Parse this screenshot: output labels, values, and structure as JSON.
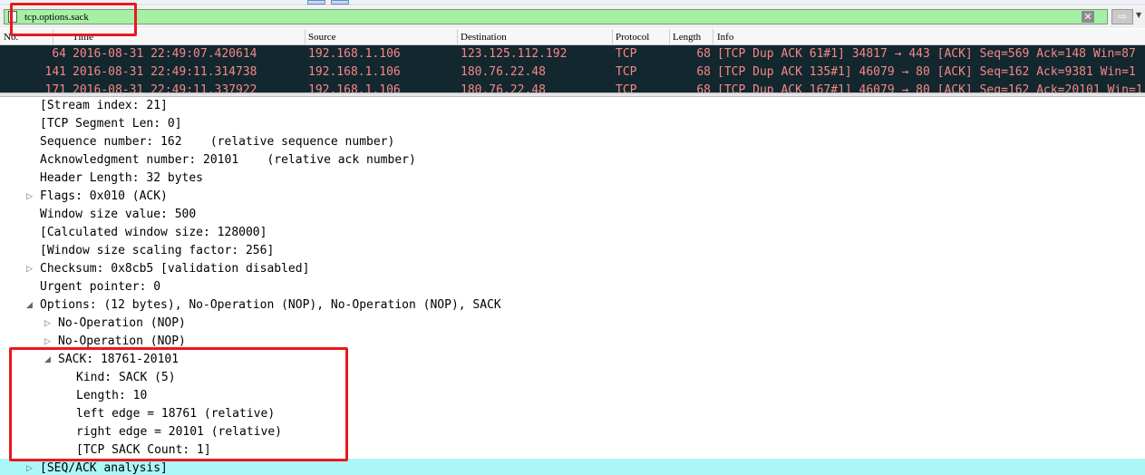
{
  "filter": {
    "value": "tcp.options.sack",
    "clear_glyph": "✕",
    "apply_glyph": "⇨",
    "dropdown_glyph": "▼"
  },
  "columns": [
    "No.",
    "Time",
    "Source",
    "Destination",
    "Protocol",
    "Length",
    "Info"
  ],
  "packets": [
    {
      "no": "64",
      "time": "2016-08-31 22:49:07.420614",
      "source": "192.168.1.106",
      "destination": "123.125.112.192",
      "protocol": "TCP",
      "length": "68",
      "info": "[TCP Dup ACK 61#1] 34817 → 443 [ACK] Seq=569 Ack=148 Win=87"
    },
    {
      "no": "141",
      "time": "2016-08-31 22:49:11.314738",
      "source": "192.168.1.106",
      "destination": "180.76.22.48",
      "protocol": "TCP",
      "length": "68",
      "info": "[TCP Dup ACK 135#1] 46079 → 80 [ACK] Seq=162 Ack=9381 Win=1"
    },
    {
      "no": "171",
      "time": "2016-08-31 22:49:11.337922",
      "source": "192.168.1.106",
      "destination": "180.76.22.48",
      "protocol": "TCP",
      "length": "68",
      "info": "[TCP Dup ACK 167#1] 46079 → 80 [ACK] Seq=162 Ack=20101 Win=1"
    }
  ],
  "tree": [
    {
      "text": "[Stream index: 21]",
      "level": 0
    },
    {
      "text": "[TCP Segment Len: 0]",
      "level": 0
    },
    {
      "text": "Sequence number: 162    (relative sequence number)",
      "level": 0
    },
    {
      "text": "Acknowledgment number: 20101    (relative ack number)",
      "level": 0
    },
    {
      "text": "Header Length: 32 bytes",
      "level": 0
    },
    {
      "text": "Flags: 0x010 (ACK)",
      "level": 0,
      "expander": "collapsed"
    },
    {
      "text": "Window size value: 500",
      "level": 0
    },
    {
      "text": "[Calculated window size: 128000]",
      "level": 0
    },
    {
      "text": "[Window size scaling factor: 256]",
      "level": 0
    },
    {
      "text": "Checksum: 0x8cb5 [validation disabled]",
      "level": 0,
      "expander": "collapsed"
    },
    {
      "text": "Urgent pointer: 0",
      "level": 0
    },
    {
      "text": "Options: (12 bytes), No-Operation (NOP), No-Operation (NOP), SACK",
      "level": 0,
      "expander": "expanded"
    },
    {
      "text": "No-Operation (NOP)",
      "level": 1,
      "expander": "collapsed"
    },
    {
      "text": "No-Operation (NOP)",
      "level": 1,
      "expander": "collapsed"
    },
    {
      "text": "SACK: 18761-20101",
      "level": 1,
      "expander": "expanded"
    },
    {
      "text": "Kind: SACK (5)",
      "level": 2
    },
    {
      "text": "Length: 10",
      "level": 2
    },
    {
      "text": "left edge = 18761 (relative)",
      "level": 2
    },
    {
      "text": "right edge = 20101 (relative)",
      "level": 2
    },
    {
      "text": "[TCP SACK Count: 1]",
      "level": 2
    },
    {
      "text": "[SEQ/ACK analysis]",
      "level": 0,
      "expander": "collapsed",
      "selected": true
    }
  ],
  "colors": {
    "filter_valid": "#a6f0a6",
    "packet_row_bg": "#12272e",
    "packet_row_fg": "#f78787",
    "selected_row": "#abf7f7",
    "annotation_red": "#e8191e"
  },
  "icons": {
    "collapsed": "triangle-right-icon",
    "expanded": "triangle-down-icon"
  }
}
